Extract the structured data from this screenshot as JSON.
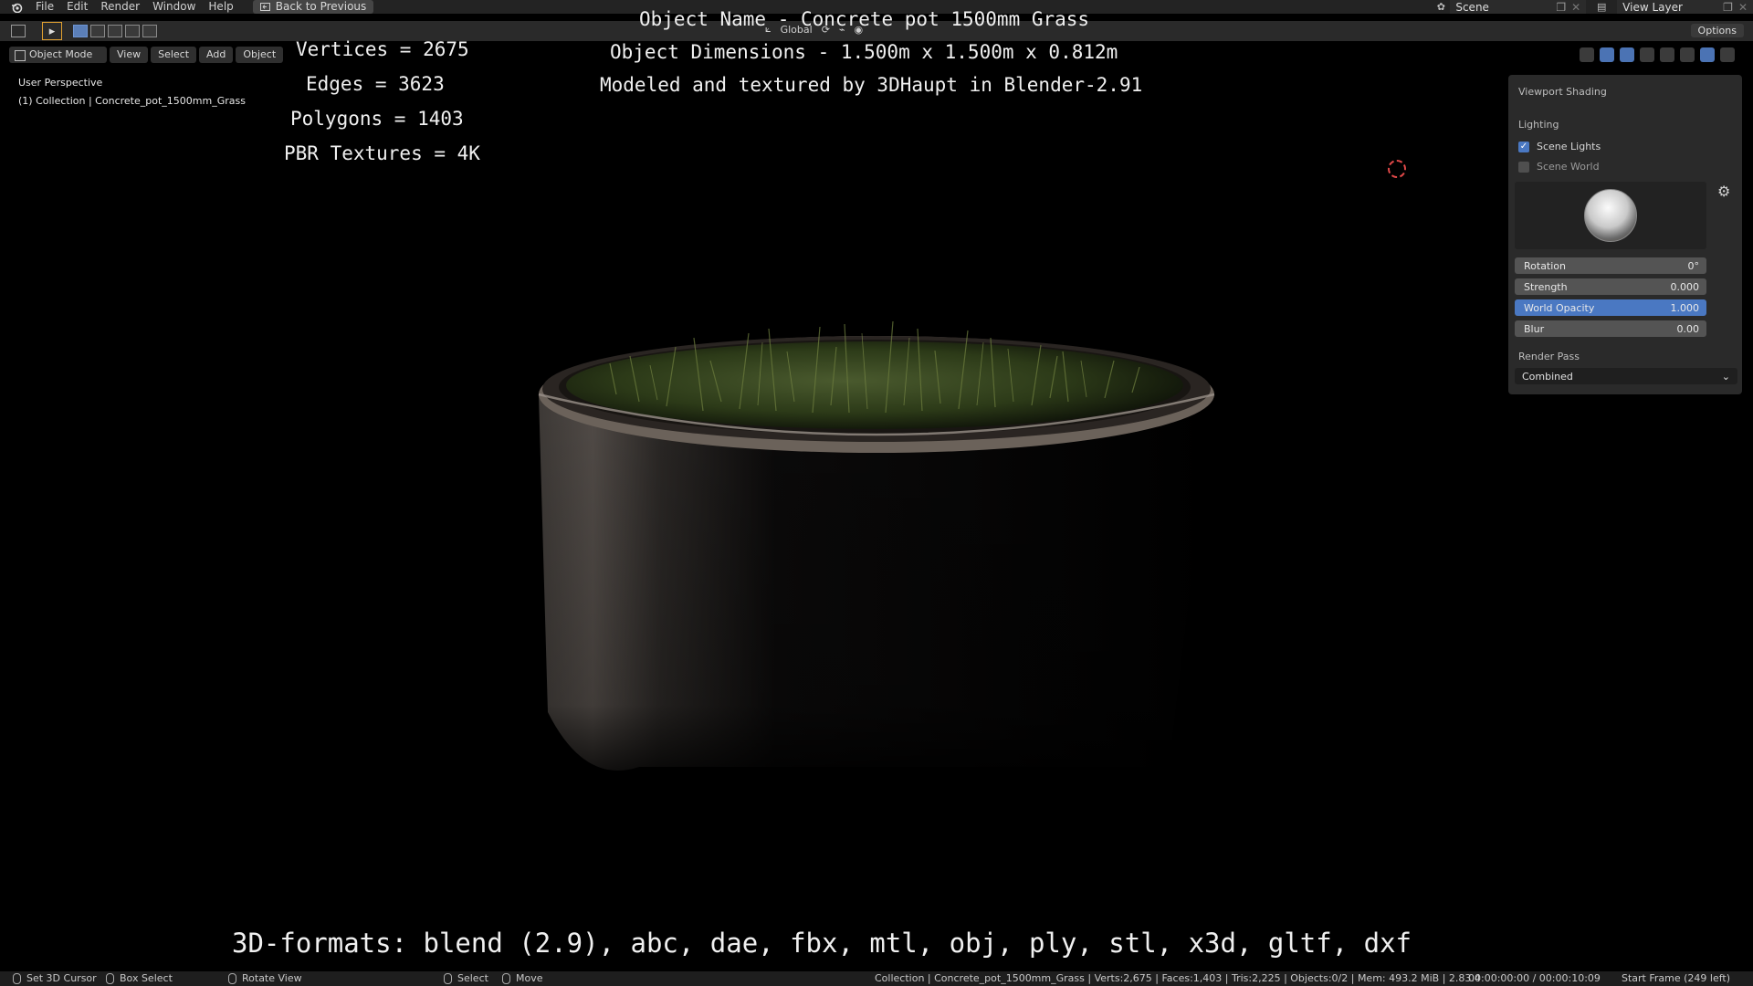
{
  "menubar": {
    "items": [
      "File",
      "Edit",
      "Render",
      "Window",
      "Help"
    ],
    "back_button": "Back to Previous",
    "scene": "Scene",
    "view_layer": "View Layer"
  },
  "toolbar": {
    "transform_orientation": "Global",
    "options": "Options"
  },
  "viewport_header": {
    "mode": "Object Mode",
    "view": "View",
    "select": "Select",
    "add": "Add",
    "object": "Object"
  },
  "viewport": {
    "perspective": "User Perspective",
    "collection": "(1) Collection | Concrete_pot_1500mm_Grass"
  },
  "overlay": {
    "vertices": "Vertices = 2675",
    "edges": "Edges = 3623",
    "polygons": "Polygons = 1403",
    "textures": "PBR Textures = 4K",
    "object_name": "Object Name - Concrete pot 1500mm Grass",
    "dimensions": "Object Dimensions -  1.500m x 1.500m x 0.812m",
    "credits": "Modeled and textured by 3DHaupt in Blender-2.91",
    "formats": "3D-formats: blend (2.9), abc, dae, fbx, mtl, obj, ply, stl, x3d, gltf, dxf"
  },
  "shading_panel": {
    "title": "Viewport Shading",
    "lighting": "Lighting",
    "scene_lights": "Scene Lights",
    "scene_lights_checked": true,
    "scene_world": "Scene World",
    "scene_world_checked": false,
    "rotation_label": "Rotation",
    "rotation_value": "0°",
    "strength_label": "Strength",
    "strength_value": "0.000",
    "world_opacity_label": "World Opacity",
    "world_opacity_value": "1.000",
    "blur_label": "Blur",
    "blur_value": "0.00",
    "render_pass": "Render Pass",
    "render_pass_value": "Combined"
  },
  "statusbar": {
    "set_cursor": "Set 3D Cursor",
    "box_select": "Box Select",
    "rotate_view": "Rotate View",
    "select": "Select",
    "move": "Move",
    "info": "Collection | Concrete_pot_1500mm_Grass | Verts:2,675 | Faces:1,403 | Tris:2,225 | Objects:0/2 | Mem: 493.2 MiB | 2.83.4",
    "time": "00:00:00:00 / 00:00:10:09",
    "start_frame": "Start Frame (249 left)"
  },
  "colors": {
    "accent_blue": "#4a78c2",
    "cursor_red": "#e04848",
    "panel_bg": "#2a2a2a"
  }
}
